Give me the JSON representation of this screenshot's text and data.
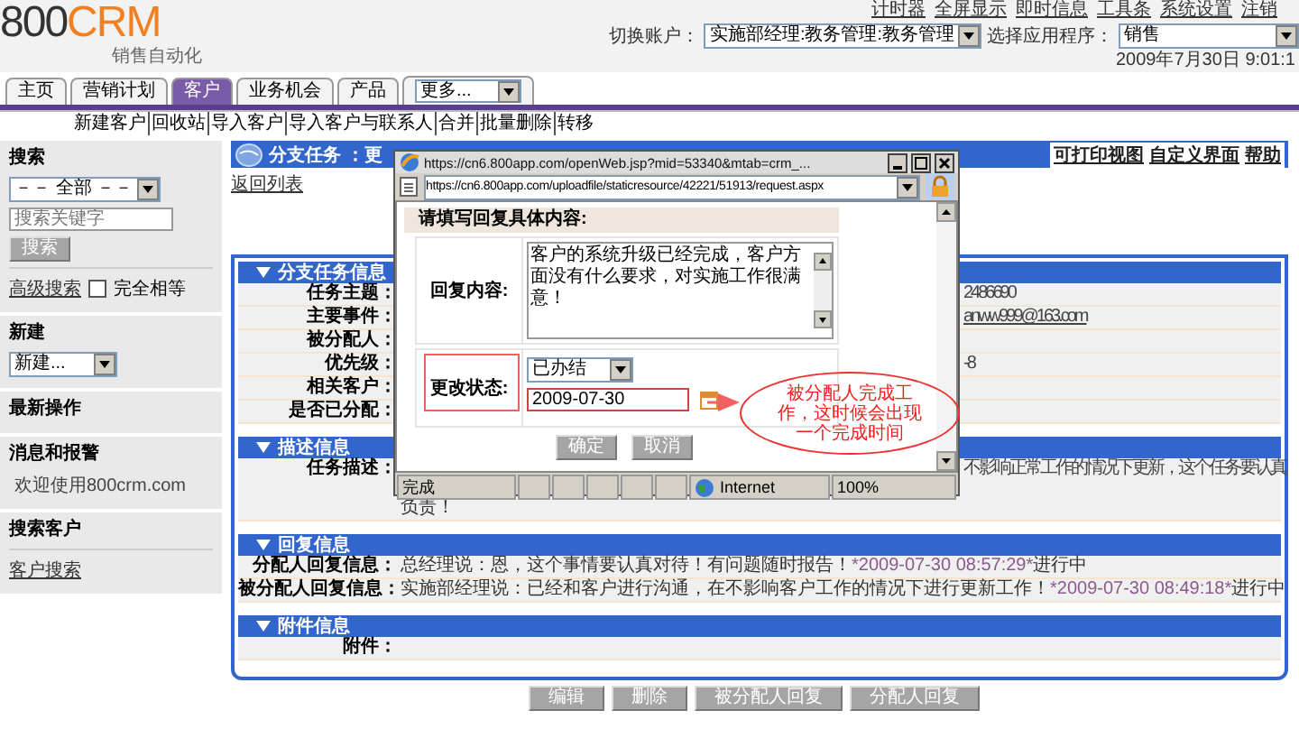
{
  "header": {
    "logo_main": "800",
    "logo_accent": "CRM",
    "logo_tagline": "销售自动化",
    "top_links": [
      "计时器",
      "全屏显示",
      "即时信息",
      "工具条",
      "系统设置",
      "注销"
    ],
    "account_label": "切换账户：",
    "account_value": "实施部经理:教务管理:教务管理",
    "app_label": "选择应用程序：",
    "app_value": "销售",
    "datetime": "2009年7月30日  9:01:1"
  },
  "tabs": [
    {
      "label": "主页",
      "selected": false
    },
    {
      "label": "营销计划",
      "selected": false
    },
    {
      "label": "客户",
      "selected": true
    },
    {
      "label": "业务机会",
      "selected": false
    },
    {
      "label": "产品",
      "selected": false
    }
  ],
  "more_select": "更多...",
  "sub_links": [
    "新建客户",
    "回收站",
    "导入客户",
    "导入客户与联系人",
    "合并",
    "批量删除",
    "转移"
  ],
  "sidebar": [
    {
      "title": "搜索",
      "select": "－－ 全部 －－",
      "placeholder": "搜索关键字",
      "button": "搜索",
      "link": "高级搜索",
      "checkbox": {
        "label": "完全相等",
        "checked": false
      }
    },
    {
      "title": "新建",
      "select": "新建..."
    },
    {
      "title": "最新操作"
    },
    {
      "title": "消息和报警",
      "text": "欢迎使用800crm.com"
    },
    {
      "title": "搜索客户",
      "link": "客户搜索"
    }
  ],
  "content": {
    "title": "分支任务 ：更",
    "tools": [
      "可打印视图",
      "自定义界面",
      "帮助"
    ],
    "back_link": "返回列表",
    "sections": [
      {
        "title": "分支任务信息",
        "rows": [
          {
            "label": "任务主题：",
            "kind": "covered",
            "value": "2486690"
          },
          {
            "label": "主要事件：",
            "kind": "covered_link",
            "value": "anww999@163.com"
          },
          {
            "label": "被分配人：",
            "kind": "covered"
          },
          {
            "label": "优先级：",
            "kind": "covered",
            "value": "-8"
          },
          {
            "label": "相关客户：",
            "kind": "covered"
          },
          {
            "label": "是否已分配：",
            "kind": "covered"
          }
        ]
      },
      {
        "title": "描述信息",
        "rows": [
          {
            "label": "任务描述：",
            "kind": "covered",
            "value": "不影响正常工作的情况下更新，这个任务要认真",
            "continuation": "负责！"
          }
        ]
      },
      {
        "title": "回复信息",
        "rows": [
          {
            "label": "分配人回复信息：",
            "kind": "reply",
            "value": "总经理说：恩，这个事情要认真对待！有问题随时报告！",
            "time": "*2009-07-30 08:57:29*",
            "status": "进行中"
          },
          {
            "label": "被分配人回复信息：",
            "kind": "reply",
            "value": "实施部经理说：已经和客户进行沟通，在不影响客户工作的情况下进行更新工作！",
            "time": "*2009-07-30 08:49:18*",
            "status": "进行中"
          }
        ]
      },
      {
        "title": "附件信息",
        "rows": [
          {
            "label": "附件：",
            "kind": "text"
          }
        ]
      }
    ],
    "actions": [
      "编辑",
      "删除",
      "被分配人回复",
      "分配人回复"
    ]
  },
  "popup": {
    "title": "https://cn6.800app.com/openWeb.jsp?mid=53340&mtab=crm_...",
    "address": "https://cn6.800app.com/uploadfile/staticresource/42221/51913/request.aspx",
    "heading": "请填写回复具体内容:",
    "reply_label": "回复内容:",
    "reply_value": "客户的系统升级已经完成，客户方面没有什么要求，对实施工作很满意！",
    "status_label": "更改状态:",
    "status_value": "已办结",
    "date_value": "2009-07-30",
    "buttons": [
      "确定",
      "取消"
    ],
    "status_text": "完成",
    "zone": "Internet",
    "zoom": "100%"
  },
  "annotation": {
    "text": "被分配人完成工作，这时候会出现一个完成时间"
  }
}
